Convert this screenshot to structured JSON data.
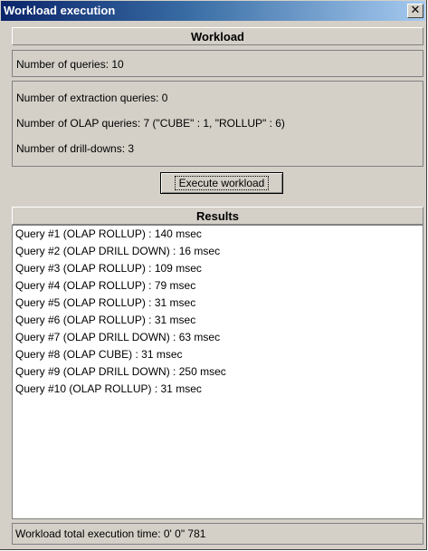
{
  "window": {
    "title": "Workload execution",
    "close_glyph": "✕"
  },
  "workload": {
    "header": "Workload",
    "num_queries": "Number of queries: 10",
    "num_extraction": "Number of extraction queries: 0",
    "num_olap": "Number of OLAP queries: 7 (\"CUBE\" : 1, \"ROLLUP\" : 6)",
    "num_drilldowns": "Number of drill-downs: 3",
    "execute_label": "Execute workload"
  },
  "results": {
    "header": "Results",
    "rows": [
      "Query #1 (OLAP ROLLUP) : 140 msec",
      "Query #2 (OLAP DRILL DOWN) : 16 msec",
      "Query #3 (OLAP ROLLUP) : 109 msec",
      "Query #4 (OLAP ROLLUP) : 79 msec",
      "Query #5 (OLAP ROLLUP) : 31 msec",
      "Query #6 (OLAP ROLLUP) : 31 msec",
      "Query #7 (OLAP DRILL DOWN) : 63 msec",
      "Query #8 (OLAP CUBE) : 31 msec",
      "Query #9 (OLAP DRILL DOWN) : 250 msec",
      "Query #10 (OLAP ROLLUP) : 31 msec"
    ],
    "total": "Workload total execution time:  0' 0\" 781"
  }
}
